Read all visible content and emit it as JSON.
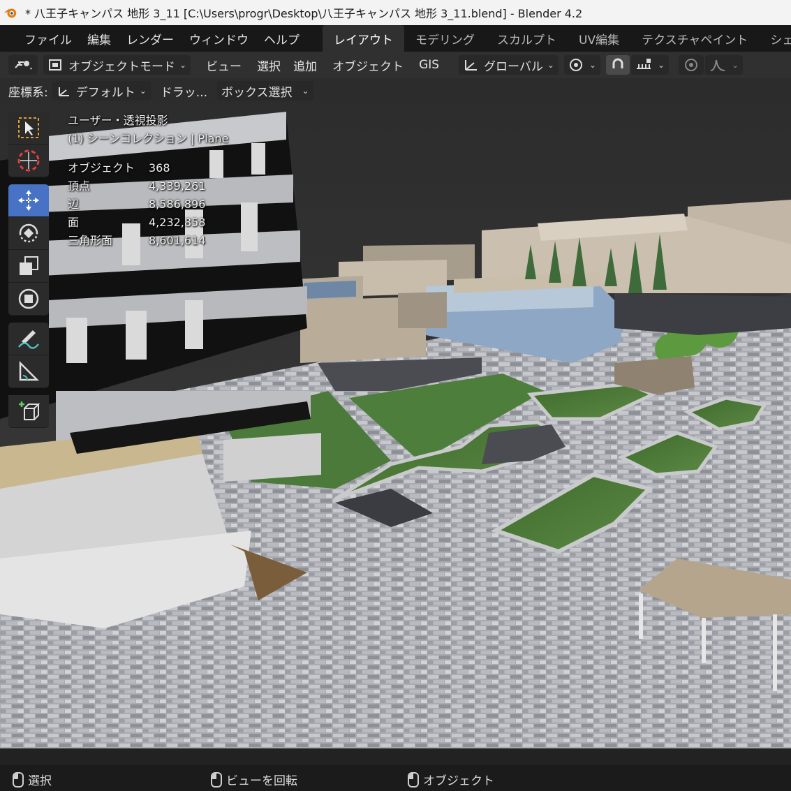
{
  "window": {
    "title": "* 八王子キャンパス 地形 3_11 [C:\\Users\\progr\\Desktop\\八王子キャンパス 地形 3_11.blend] - Blender 4.2"
  },
  "menu": [
    "ファイル",
    "編集",
    "レンダー",
    "ウィンドウ",
    "ヘルプ"
  ],
  "workspaces": [
    "レイアウト",
    "モデリング",
    "スカルプト",
    "UV編集",
    "テクスチャペイント",
    "シェ"
  ],
  "header": {
    "mode": "オブジェクトモード",
    "view": "ビュー",
    "select": "選択",
    "add": "追加",
    "object": "オブジェクト",
    "gis": "GIS",
    "orientation": "グローバル"
  },
  "header2": {
    "coord_label": "座標系:",
    "coord_value": "デフォルト",
    "drag_label": "ドラッ...",
    "select_mode": "ボックス選択"
  },
  "overlay": {
    "view_name": "ユーザー・透視投影",
    "collection": "(1) シーンコレクション | Plane",
    "stats": [
      {
        "label": "オブジェクト",
        "value": "368"
      },
      {
        "label": "頂点",
        "value": "4,339,261"
      },
      {
        "label": "辺",
        "value": "8,586,896"
      },
      {
        "label": "面",
        "value": "4,232,858"
      },
      {
        "label": "三角形面",
        "value": "8,601,614"
      }
    ]
  },
  "tools": [
    "select-box-icon",
    "cursor-icon",
    "move-icon",
    "rotate-icon",
    "scale-icon",
    "transform-icon",
    "annotate-icon",
    "measure-icon",
    "add-cube-icon"
  ],
  "status": {
    "left": "選択",
    "middle": "ビューを回転",
    "right": "オブジェクト"
  },
  "colors": {
    "accent": "#4872c4",
    "header_bg": "#303030",
    "grass": "#4e7a3a",
    "paving": "#9a9ca2"
  }
}
